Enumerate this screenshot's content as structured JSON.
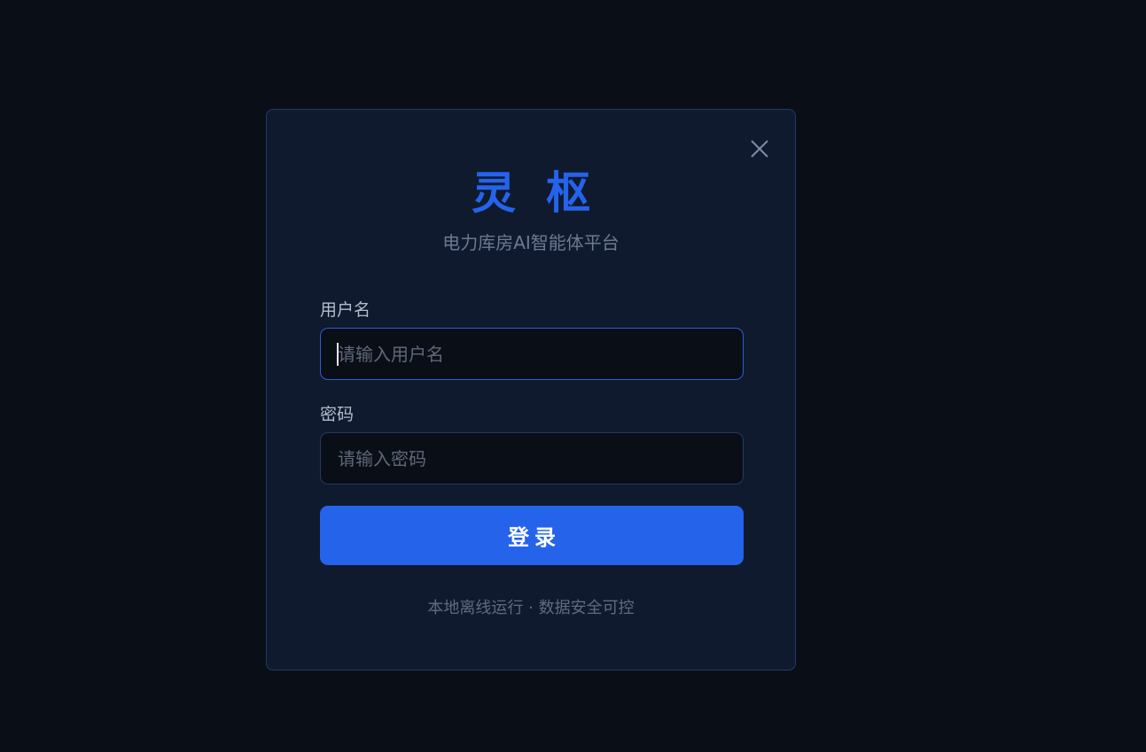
{
  "login_dialog": {
    "title": "灵枢",
    "subtitle": "电力库房AI智能体平台",
    "username": {
      "label": "用户名",
      "placeholder": "请输入用户名",
      "value": ""
    },
    "password": {
      "label": "密码",
      "placeholder": "请输入密码",
      "value": ""
    },
    "login_button_label": "登录",
    "footer_text": "本地离线运行 · 数据安全可控",
    "close_icon": "close-icon"
  },
  "colors": {
    "background": "#0a0e17",
    "panel": "#0f1a2e",
    "accent": "#2563eb",
    "panel_border": "#1f3a6e"
  }
}
